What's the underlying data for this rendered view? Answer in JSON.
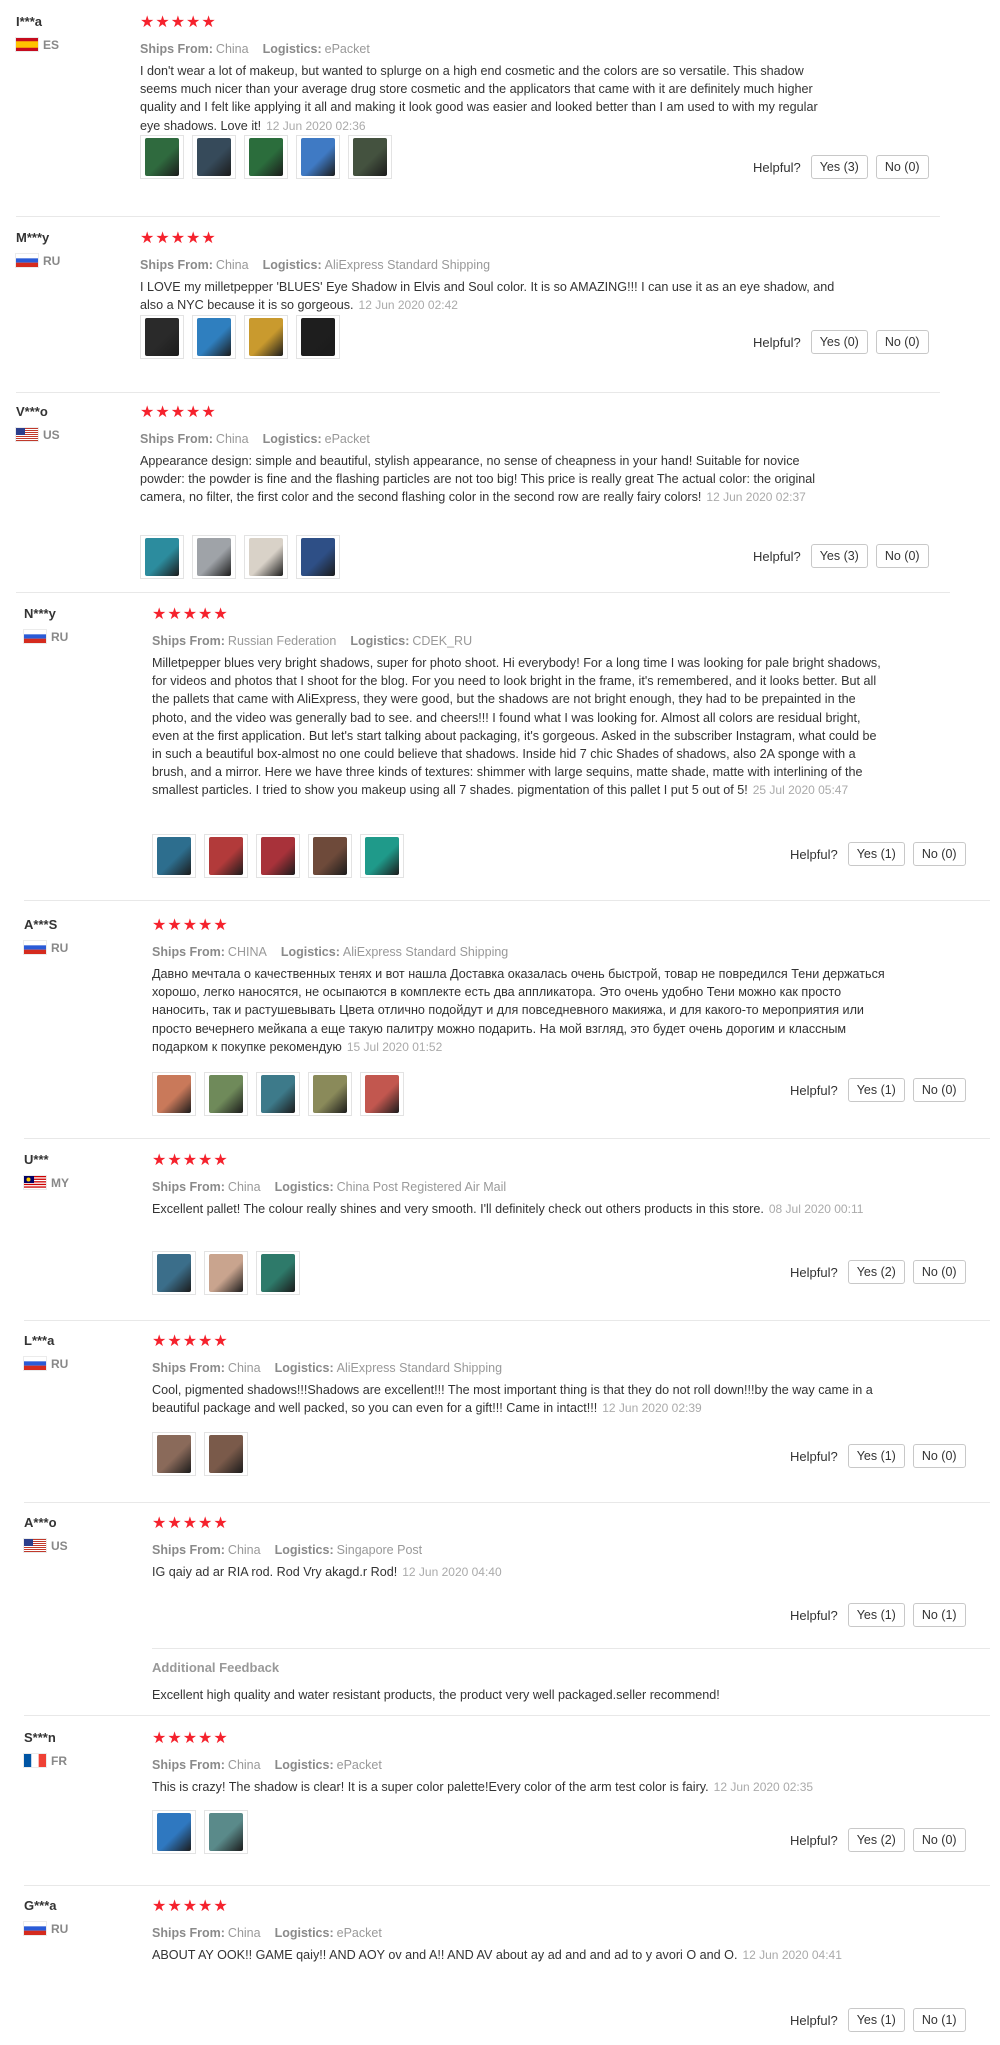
{
  "ui": {
    "ships_from_label": "Ships From:",
    "logistics_label": "Logistics:",
    "helpful_label": "Helpful?",
    "star_color": "#f5222d"
  },
  "reviews": [
    {
      "user": "I***a",
      "country": "ES",
      "flag": "flag-es-icon",
      "stars": "★★★★★",
      "ships_from": "China",
      "logistics": "ePacket",
      "text": "I don't wear a lot of makeup, but wanted to splurge on a high end cosmetic and the colors are so versatile. This shadow seems much nicer than your average drug store cosmetic and the applicators that came with it are definitely much higher quality and I felt like applying it all and making it look good was easier and looked better than I am used to with my regular eye shadows. Love it!",
      "date": "12 Jun 2020 02:36",
      "photos": [
        "#2f6a3e",
        "#364a5a",
        "#2b6d3c",
        "#3f7ac4",
        "#44523f"
      ],
      "yes": "Yes (3)",
      "no": "No (0)"
    },
    {
      "user": "M***y",
      "country": "RU",
      "flag": "flag-ru-icon",
      "stars": "★★★★★",
      "ships_from": "China",
      "logistics": "AliExpress Standard Shipping",
      "text": "I LOVE my milletpepper 'BLUES' Eye Shadow in Elvis and Soul color. It is so AMAZING!!! I can use it as an eye shadow, and also a NYC because it is so gorgeous.",
      "date": "12 Jun 2020 02:42",
      "photos": [
        "#2a2a2a",
        "#2f7fbf",
        "#c99a2e",
        "#1e1e1e"
      ],
      "yes": "Yes (0)",
      "no": "No (0)"
    },
    {
      "user": "V***o",
      "country": "US",
      "flag": "flag-us-icon",
      "stars": "★★★★★",
      "ships_from": "China",
      "logistics": "ePacket",
      "text": "Appearance design: simple and beautiful, stylish appearance, no sense of cheapness in your hand! Suitable for novice powder: the powder is fine and the flashing particles are not too big! This price is really great The actual color: the original camera, no filter, the first color and the second flashing color in the second row are really fairy colors!",
      "date": "12 Jun 2020 02:37",
      "photos": [
        "#2c8c9e",
        "#9fa3a8",
        "#d9d2c8",
        "#2e4f86"
      ],
      "yes": "Yes (3)",
      "no": "No (0)"
    },
    {
      "user": "N***y",
      "country": "RU",
      "flag": "flag-ru-icon",
      "stars": "★★★★★",
      "ships_from": "Russian Federation",
      "logistics": "CDEK_RU",
      "text": "Milletpepper blues very bright shadows, super for photo shoot. Hi everybody! For a long time I was looking for pale bright shadows, for videos and photos that I shoot for the blog. For you need to look bright in the frame, it's remembered, and it looks better. But all the pallets that came with AliExpress, they were good, but the shadows are not bright enough, they had to be prepainted in the photo, and the video was generally bad to see. and cheers!!! I found what I was looking for. Almost all colors are residual bright, even at the first application. But let's start talking about packaging, it's gorgeous. Asked in the subscriber Instagram, what could be in such a beautiful box-almost no one could believe that shadows. Inside hid 7 chic Shades of shadows, also 2A sponge with a brush, and a mirror. Here we have three kinds of textures: shimmer with large sequins, matte shade, matte with interlining of the smallest particles. I tried to show you makeup using all 7 shades. pigmentation of this pallet I put 5 out of 5!",
      "date": "25 Jul 2020 05:47",
      "photos": [
        "#2d6e8e",
        "#b23a3a",
        "#a8323a",
        "#6e4a3a",
        "#1f9a8a"
      ],
      "yes": "Yes (1)",
      "no": "No (0)"
    },
    {
      "user": "A***S",
      "country": "RU",
      "flag": "flag-ru-icon",
      "stars": "★★★★★",
      "ships_from": "CHINA",
      "logistics": "AliExpress Standard Shipping",
      "text": "Давно мечтала о качественных тенях и вот нашла Доставка оказалась очень быстрой, товар не повредился Тени держаться хорошо, легко наносятся, не осыпаются в комплекте есть два аппликатора. Это очень удобно Тени можно как просто наносить, так и растушевывать Цвета отлично подойдут и для повседневного макияжа, и для какого-то мероприятия или просто вечернего мейкапа а еще такую палитру можно подарить. На мой взгляд, это будет очень дорогим и классным подарком к покупке рекомендую",
      "date": "15 Jul 2020 01:52",
      "photos": [
        "#c9795a",
        "#6f8a5a",
        "#3d7a8a",
        "#8a8a5a",
        "#c2574f"
      ],
      "yes": "Yes (1)",
      "no": "No (0)"
    },
    {
      "user": "U***",
      "country": "MY",
      "flag": "flag-my-icon",
      "stars": "★★★★★",
      "ships_from": "China",
      "logistics": "China Post Registered Air Mail",
      "text": "Excellent pallet! The colour really shines and very smooth. I'll definitely check out others products in this store.",
      "date": "08 Jul 2020 00:11",
      "photos": [
        "#3b6e8a",
        "#c9a48e",
        "#2e7a6a"
      ],
      "yes": "Yes (2)",
      "no": "No (0)"
    },
    {
      "user": "L***a",
      "country": "RU",
      "flag": "flag-ru-icon",
      "stars": "★★★★★",
      "ships_from": "China",
      "logistics": "AliExpress Standard Shipping",
      "text": "Cool, pigmented shadows!!!Shadows are excellent!!! The most important thing is that they do not roll down!!!by the way came in a beautiful package and well packed, so you can even for a gift!!! Came in intact!!!",
      "date": "12 Jun 2020 02:39",
      "photos": [
        "#8a6a5a",
        "#7a5a4a"
      ],
      "yes": "Yes (1)",
      "no": "No (0)"
    },
    {
      "user": "A***o",
      "country": "US",
      "flag": "flag-us-icon",
      "stars": "★★★★★",
      "ships_from": "China",
      "logistics": "Singapore Post",
      "text": "IG qaiy ad ar RIA rod. Rod Vry akagd.r Rod!",
      "date": "12 Jun 2020 04:40",
      "photos": [],
      "yes": "Yes (1)",
      "no": "No (1)",
      "additional": {
        "heading": "Additional Feedback",
        "text": "Excellent high quality and water resistant products, the product very well packaged.seller recommend!"
      }
    },
    {
      "user": "S***n",
      "country": "FR",
      "flag": "flag-fr-icon",
      "stars": "★★★★★",
      "ships_from": "China",
      "logistics": "ePacket",
      "text": "This is crazy! The shadow is clear! It is a super color palette!Every color of the arm test color is fairy.",
      "date": "12 Jun 2020 02:35",
      "photos": [
        "#2f78c0",
        "#5a8a8a"
      ],
      "yes": "Yes (2)",
      "no": "No (0)"
    },
    {
      "user": "G***a",
      "country": "RU",
      "flag": "flag-ru-icon",
      "stars": "★★★★★",
      "ships_from": "China",
      "logistics": "ePacket",
      "text": "ABOUT AY OOK!! GAME qaiy!! AND AOY ov and A!! AND AV about ay ad and and ad to y avori O and O.",
      "date": "12 Jun 2020 04:41",
      "photos": [],
      "yes": "Yes (1)",
      "no": "No (1)"
    }
  ]
}
